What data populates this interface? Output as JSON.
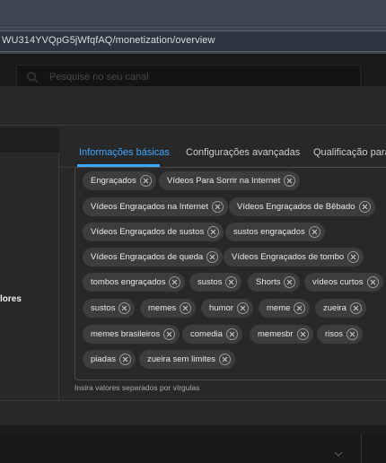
{
  "browser": {
    "url": "WU314YVQpG5jWfqfAQ/monetization/overview"
  },
  "studio": {
    "search_placeholder": "Pesquise no seu canal"
  },
  "dialog": {
    "left_label": "lores",
    "tabs": [
      {
        "label": "Informações básicas",
        "active": true
      },
      {
        "label": "Configurações avançadas",
        "active": false
      },
      {
        "label": "Qualificação para",
        "active": false
      }
    ],
    "tags": [
      "Engraçados",
      "Vídeos Para Sorrir na Internet",
      "Vídeos Engraçados na Internet",
      "Vídeos Engraçados de Bêbado",
      "Vídeos Engraçados de sustos",
      "sustos engraçados",
      "Vídeos Engraçados de queda",
      "Vídeos Engraçados de tombo",
      "tombos engraçados",
      "sustos",
      "Shorts",
      "vídeos curtos",
      "sustos",
      "memes",
      "humor",
      "meme",
      "zueira",
      "memes brasileiros",
      "comedia",
      "memesbr",
      "risos",
      "piadas",
      "zueira sem limites"
    ],
    "helper_text": "Insira valores separados por vírgulas"
  },
  "colors": {
    "accent": "#3ea6ff",
    "dialog_bg": "#282828",
    "chip_bg": "#3d3d3d"
  }
}
